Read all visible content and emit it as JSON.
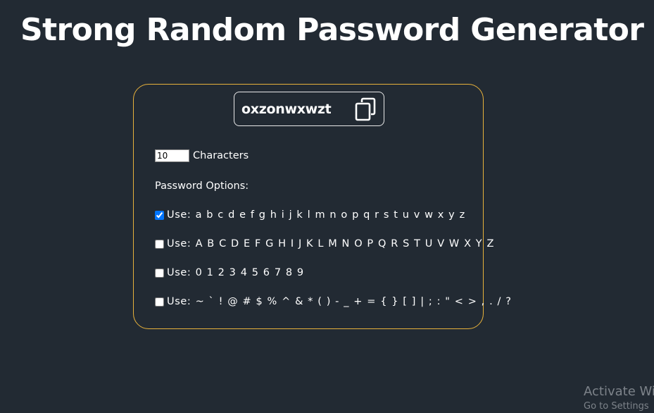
{
  "header": {
    "title": "Strong Random Password Generator"
  },
  "generator": {
    "password": "oxzonwxwzt",
    "copy_icon": "copy-icon",
    "length_value": "10",
    "length_label": "Characters",
    "options_heading": "Password Options:",
    "options": [
      {
        "label": "Use: a b c d e f g h i j k l m n o p q r s t u v w x y z",
        "checked": true
      },
      {
        "label": "Use: A B C D E F G H I J K L M N O P Q R S T U V W X Y Z",
        "checked": false
      },
      {
        "label": "Use: 0 1 2 3 4 5 6 7 8 9",
        "checked": false
      },
      {
        "label": "Use: ~ ` ! @ # $ % ^ & * ( ) - _ + = { } [ ] | ; : \" < > , . / ?",
        "checked": false
      }
    ]
  },
  "watermark": {
    "title": "Activate Wi",
    "subtitle": "Go to Settings"
  },
  "colors": {
    "background": "#222a33",
    "card_border": "#e7b13b",
    "text": "#ffffff",
    "checkbox_accent": "#0075ff"
  }
}
